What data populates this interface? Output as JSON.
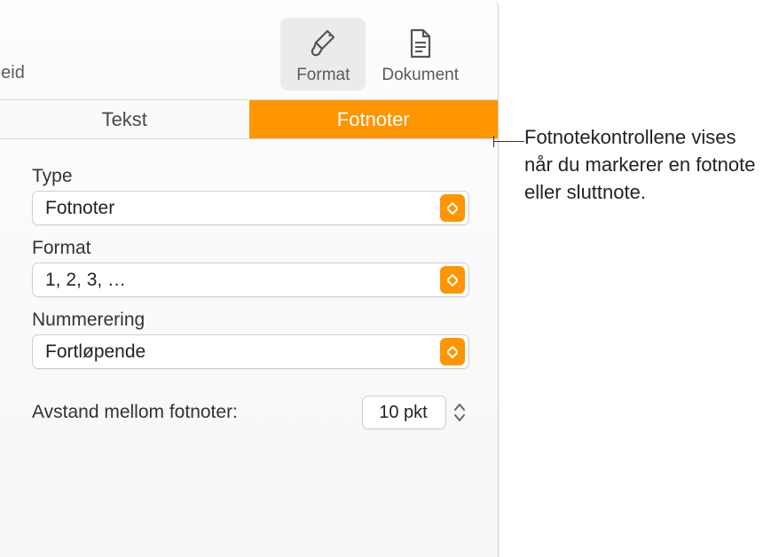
{
  "toolbar": {
    "left_text": "beid",
    "format": {
      "label": "Format"
    },
    "document": {
      "label": "Dokument"
    }
  },
  "tabs": {
    "text": "Tekst",
    "footnotes": "Fotnoter"
  },
  "fields": {
    "type": {
      "label": "Type",
      "value": "Fotnoter"
    },
    "format": {
      "label": "Format",
      "value": "1, 2, 3, …"
    },
    "numbering": {
      "label": "Nummerering",
      "value": "Fortløpende"
    },
    "spacing": {
      "label": "Avstand mellom fotnoter:",
      "value": "10 pkt"
    }
  },
  "callout": {
    "text": "Fotnotekontrollene vises når du markerer en fotnote eller sluttnote."
  }
}
